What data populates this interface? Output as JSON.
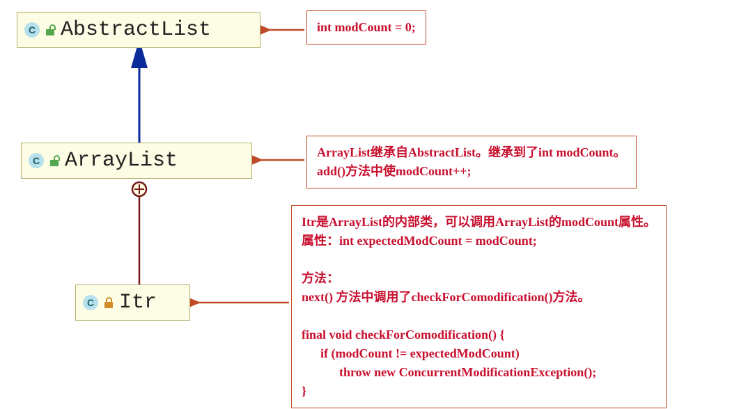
{
  "nodes": {
    "abstractList": {
      "name": "AbstractList",
      "visibility": "public"
    },
    "arrayList": {
      "name": "ArrayList",
      "visibility": "public"
    },
    "itr": {
      "name": "Itr",
      "visibility": "private"
    }
  },
  "notes": {
    "abstractList": "int modCount = 0;",
    "arrayList": "ArrayList继承自AbstractList。继承到了int modCount。\nadd()方法中使modCount++;",
    "itr": "Itr是ArrayList的内部类，可以调用ArrayList的modCount属性。\n属性：int expectedModCount = modCount;\n\n方法：\nnext() 方法中调用了checkForComodification()方法。\n\nfinal void checkForComodification() {\n      if (modCount != expectedModCount)\n            throw new ConcurrentModificationException();\n}"
  },
  "icon_glyph": "C",
  "relations": {
    "arrayList_to_abstractList": "inheritance",
    "itr_to_arrayList": "inner-class"
  },
  "colors": {
    "note_border": "#c04a27",
    "note_text": "#c8102e",
    "node_fill": "#fdfde5",
    "node_border": "#b3af6e",
    "inherit_arrow": "#0a2b99",
    "inner_line": "#7a1a1a"
  }
}
